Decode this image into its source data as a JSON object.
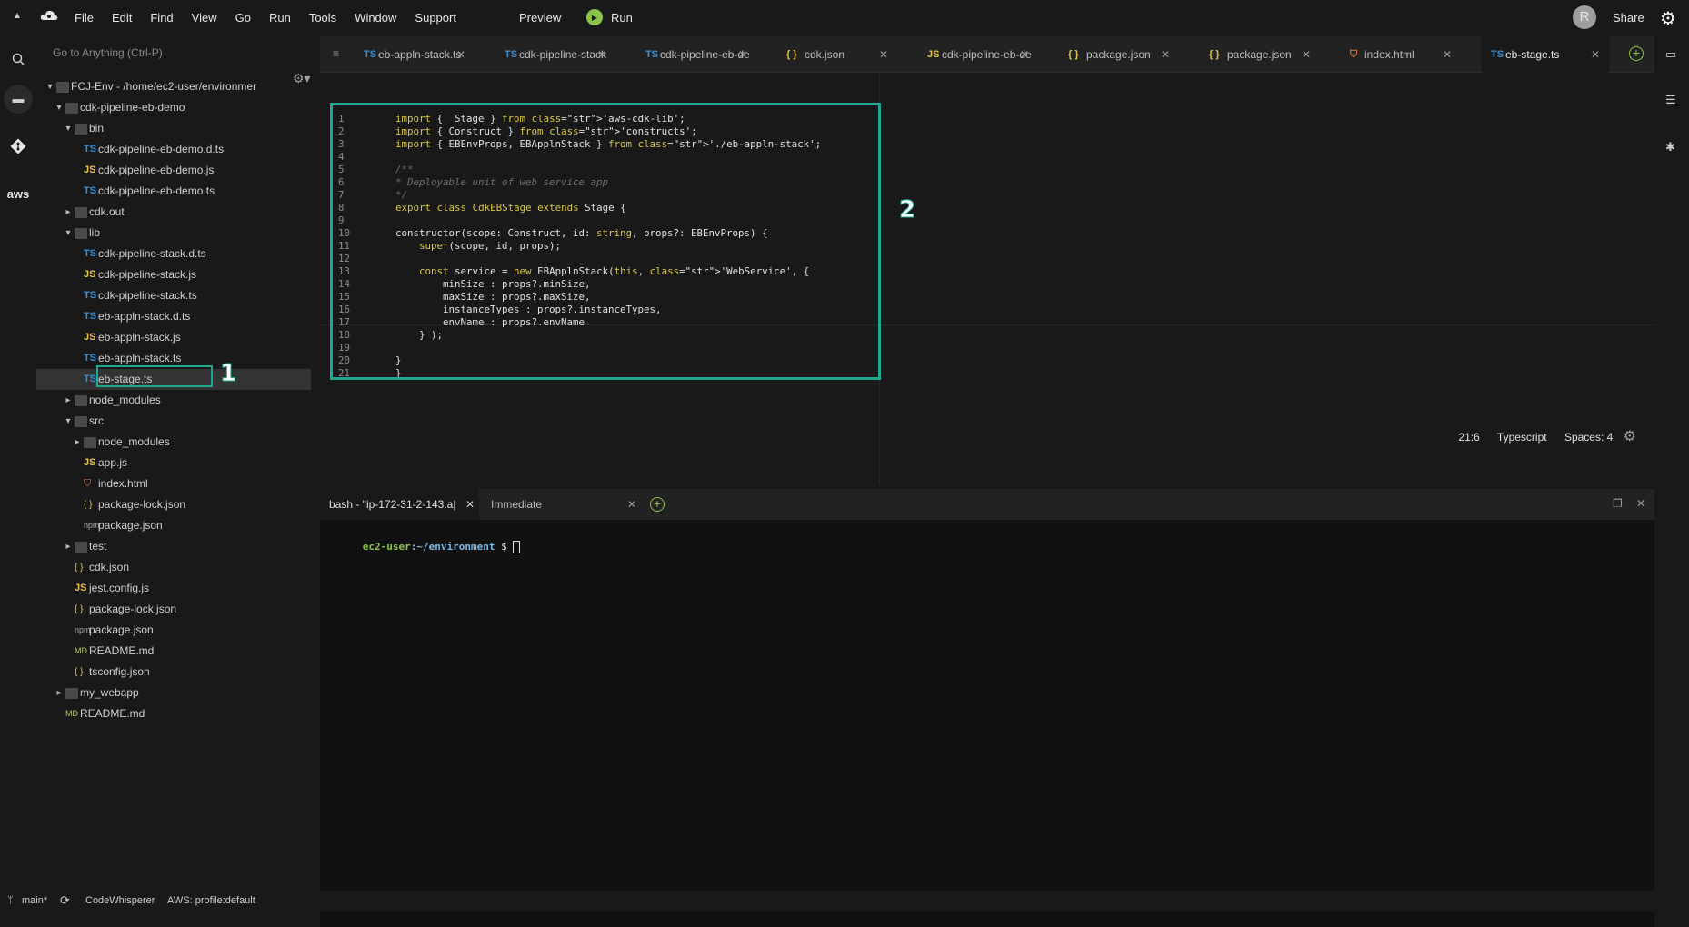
{
  "menubar": {
    "items": [
      "File",
      "Edit",
      "Find",
      "View",
      "Go",
      "Run",
      "Tools",
      "Window",
      "Support"
    ],
    "preview": "Preview",
    "run": "Run",
    "avatar": "R",
    "share": "Share"
  },
  "sidebar": {
    "goto_placeholder": "Go to Anything (Ctrl-P)",
    "tree": [
      {
        "label": "FCJ-Env - /home/ec2-user/environmer",
        "depth": 0,
        "kind": "root",
        "open": true
      },
      {
        "label": "cdk-pipeline-eb-demo",
        "depth": 1,
        "kind": "folder",
        "open": true
      },
      {
        "label": "bin",
        "depth": 2,
        "kind": "folder",
        "open": true
      },
      {
        "label": "cdk-pipeline-eb-demo.d.ts",
        "depth": 3,
        "kind": "ts"
      },
      {
        "label": "cdk-pipeline-eb-demo.js",
        "depth": 3,
        "kind": "js"
      },
      {
        "label": "cdk-pipeline-eb-demo.ts",
        "depth": 3,
        "kind": "ts"
      },
      {
        "label": "cdk.out",
        "depth": 2,
        "kind": "folder",
        "open": false
      },
      {
        "label": "lib",
        "depth": 2,
        "kind": "folder",
        "open": true
      },
      {
        "label": "cdk-pipeline-stack.d.ts",
        "depth": 3,
        "kind": "ts"
      },
      {
        "label": "cdk-pipeline-stack.js",
        "depth": 3,
        "kind": "js"
      },
      {
        "label": "cdk-pipeline-stack.ts",
        "depth": 3,
        "kind": "ts"
      },
      {
        "label": "eb-appln-stack.d.ts",
        "depth": 3,
        "kind": "ts"
      },
      {
        "label": "eb-appln-stack.js",
        "depth": 3,
        "kind": "js"
      },
      {
        "label": "eb-appln-stack.ts",
        "depth": 3,
        "kind": "ts"
      },
      {
        "label": "eb-stage.ts",
        "depth": 3,
        "kind": "ts",
        "selected": true
      },
      {
        "label": "node_modules",
        "depth": 2,
        "kind": "folder",
        "open": false
      },
      {
        "label": "src",
        "depth": 2,
        "kind": "folder",
        "open": true
      },
      {
        "label": "node_modules",
        "depth": 3,
        "kind": "folder",
        "open": false
      },
      {
        "label": "app.js",
        "depth": 3,
        "kind": "js"
      },
      {
        "label": "index.html",
        "depth": 3,
        "kind": "html"
      },
      {
        "label": "package-lock.json",
        "depth": 3,
        "kind": "json"
      },
      {
        "label": "package.json",
        "depth": 3,
        "kind": "npm"
      },
      {
        "label": "test",
        "depth": 2,
        "kind": "folder",
        "open": false
      },
      {
        "label": "cdk.json",
        "depth": 2,
        "kind": "json"
      },
      {
        "label": "jest.config.js",
        "depth": 2,
        "kind": "js"
      },
      {
        "label": "package-lock.json",
        "depth": 2,
        "kind": "json"
      },
      {
        "label": "package.json",
        "depth": 2,
        "kind": "npm"
      },
      {
        "label": "README.md",
        "depth": 2,
        "kind": "md"
      },
      {
        "label": "tsconfig.json",
        "depth": 2,
        "kind": "json"
      },
      {
        "label": "my_webapp",
        "depth": 1,
        "kind": "folder",
        "open": false
      },
      {
        "label": "README.md",
        "depth": 1,
        "kind": "md"
      }
    ]
  },
  "tabs": [
    {
      "icon": "TS",
      "label": "eb-appln-stack.ts"
    },
    {
      "icon": "TS",
      "label": "cdk-pipeline-stack"
    },
    {
      "icon": "TS",
      "label": "cdk-pipeline-eb-de"
    },
    {
      "icon": "{ }",
      "label": "cdk.json"
    },
    {
      "icon": "JS",
      "label": "cdk-pipeline-eb-de"
    },
    {
      "icon": "{ }",
      "label": "package.json"
    },
    {
      "icon": "{ }",
      "label": "package.json"
    },
    {
      "icon": "HTML",
      "label": "index.html"
    },
    {
      "icon": "TS",
      "label": "eb-stage.ts",
      "active": true
    }
  ],
  "editor": {
    "lines": [
      "import {  Stage } from 'aws-cdk-lib';",
      "import { Construct } from 'constructs';",
      "import { EBEnvProps, EBApplnStack } from './eb-appln-stack';",
      "",
      "/**",
      "* Deployable unit of web service app",
      "*/",
      "export class CdkEBStage extends Stage {",
      "",
      "constructor(scope: Construct, id: string, props?: EBEnvProps) {",
      "    super(scope, id, props);",
      "",
      "    const service = new EBApplnStack(this, 'WebService', {",
      "        minSize : props?.minSize,",
      "        maxSize : props?.maxSize,",
      "        instanceTypes : props?.instanceTypes,",
      "        envName : props?.envName",
      "    } );",
      "",
      "}",
      "}"
    ],
    "cursor": "21:6",
    "language": "Typescript",
    "spaces": "Spaces: 4"
  },
  "annotations": {
    "badge1": "1",
    "badge2": "2"
  },
  "terminal": {
    "tab1": "bash - \"ip-172-31-2-143.a|",
    "tab2": "Immediate",
    "prompt_user": "ec2-user",
    "prompt_path": ":~/environment",
    "prompt_symbol": " $ "
  },
  "statusbar": {
    "branch": "main*",
    "codewhisperer": "CodeWhisperer",
    "aws": "AWS: profile:default"
  }
}
